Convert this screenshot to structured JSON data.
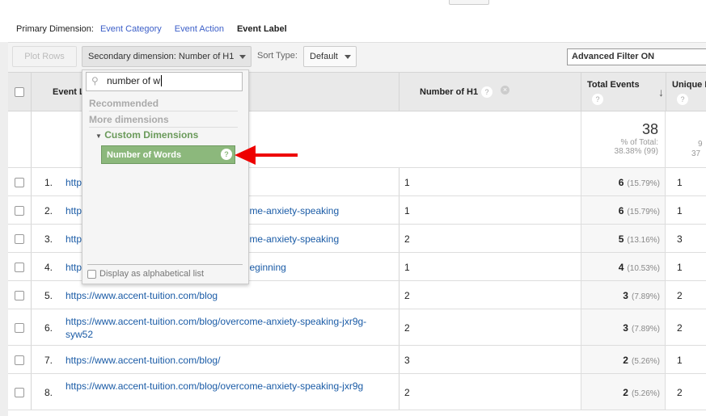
{
  "primary_dimension": {
    "label": "Primary Dimension:",
    "options": [
      "Event Category",
      "Event Action"
    ],
    "current": "Event Label"
  },
  "toolbar": {
    "plot_rows": "Plot Rows",
    "secondary_dimension": "Secondary dimension: Number of H1",
    "sort_type_label": "Sort Type:",
    "sort_type_value": "Default",
    "advanced_filter": "Advanced Filter ON"
  },
  "dropdown": {
    "search_value": "number of w",
    "recommended": "Recommended",
    "more_dimensions": "More dimensions",
    "group": "Custom Dimensions",
    "selected_option": "Number of Words",
    "alphabetical": "Display as alphabetical list"
  },
  "table": {
    "headers": {
      "event_label": "Event Label",
      "number_of_h1": "Number of H1",
      "total_events": "Total Events",
      "unique_events": "Unique Events"
    },
    "summary": {
      "total_events": "38",
      "pct_label": "% of Total:",
      "pct_value": "38.38% (99)",
      "unique_partial_1": "9",
      "unique_partial_2": "37"
    },
    "rows": [
      {
        "num": "1.",
        "label": "https://www.accent-tuition.com/",
        "h1": "1",
        "te": "6",
        "pct": "(15.79%)",
        "ue": "1"
      },
      {
        "num": "2.",
        "label": "https://www.accent-tuition.com/blog/overcome-anxiety-speaking",
        "h1": "1",
        "te": "6",
        "pct": "(15.79%)",
        "ue": "1"
      },
      {
        "num": "3.",
        "label": "https://www.accent-tuition.com/blog/overcome-anxiety-speaking",
        "h1": "2",
        "te": "5",
        "pct": "(13.16%)",
        "ue": "3"
      },
      {
        "num": "4.",
        "label": "https://www.accent-tuition.com/blog/everybeginning",
        "h1": "1",
        "te": "4",
        "pct": "(10.53%)",
        "ue": "1"
      },
      {
        "num": "5.",
        "label": "https://www.accent-tuition.com/blog",
        "h1": "2",
        "te": "3",
        "pct": "(7.89%)",
        "ue": "2"
      },
      {
        "num": "6.",
        "label": "https://www.accent-tuition.com/blog/overcome-anxiety-speaking-jxr9g-syw52",
        "h1": "2",
        "te": "3",
        "pct": "(7.89%)",
        "ue": "2"
      },
      {
        "num": "7.",
        "label": "https://www.accent-tuition.com/blog/",
        "h1": "3",
        "te": "2",
        "pct": "(5.26%)",
        "ue": "1"
      },
      {
        "num": "8.",
        "label": "https://www.accent-tuition.com/blog/overcome-anxiety-speaking-jxr9g",
        "h1": "2",
        "te": "2",
        "pct": "(5.26%)",
        "ue": "2"
      }
    ]
  },
  "colors": {
    "link": "#1a5ba6",
    "selected_option": "#8cb87c",
    "arrow": "#ee0000"
  }
}
